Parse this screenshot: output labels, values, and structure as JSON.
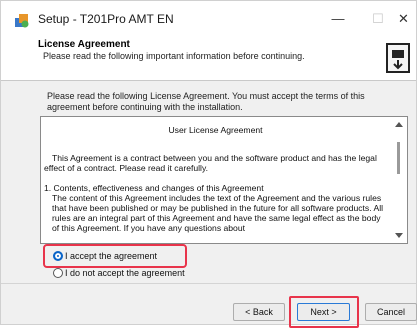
{
  "window": {
    "title": "Setup - T201Pro AMT EN",
    "controls": {
      "minimize": "—",
      "maximize": "☐",
      "close": "✕"
    }
  },
  "header": {
    "title": "License Agreement",
    "subtitle": "Please read the following important information before continuing."
  },
  "intro_text": "Please read the following License Agreement. You must accept the terms of this agreement before continuing with the installation.",
  "license": {
    "heading": "User License Agreement",
    "paragraph1": "This Agreement is a contract between you and the software product and has the legal effect of a contract. Please read it carefully.",
    "section_title": "1. Contents, effectiveness and changes of this Agreement",
    "section_body": "The content of this Agreement includes the text of the Agreement and the various rules that have been published or may be published in the future for all software products. All rules are an integral part of this Agreement and have the same legal effect as the body of this Agreement. If you have any questions about"
  },
  "options": {
    "accept_label": "I accept the agreement",
    "decline_label": "I do not accept the agreement",
    "selected": "accept"
  },
  "buttons": {
    "back": "< Back",
    "next": "Next >",
    "cancel": "Cancel"
  },
  "colors": {
    "highlight": "#e8344b",
    "accent": "#0a64c8"
  },
  "icons": [
    "setup-app-icon",
    "installer-box-icon",
    "scroll-up-icon",
    "scroll-down-icon"
  ]
}
